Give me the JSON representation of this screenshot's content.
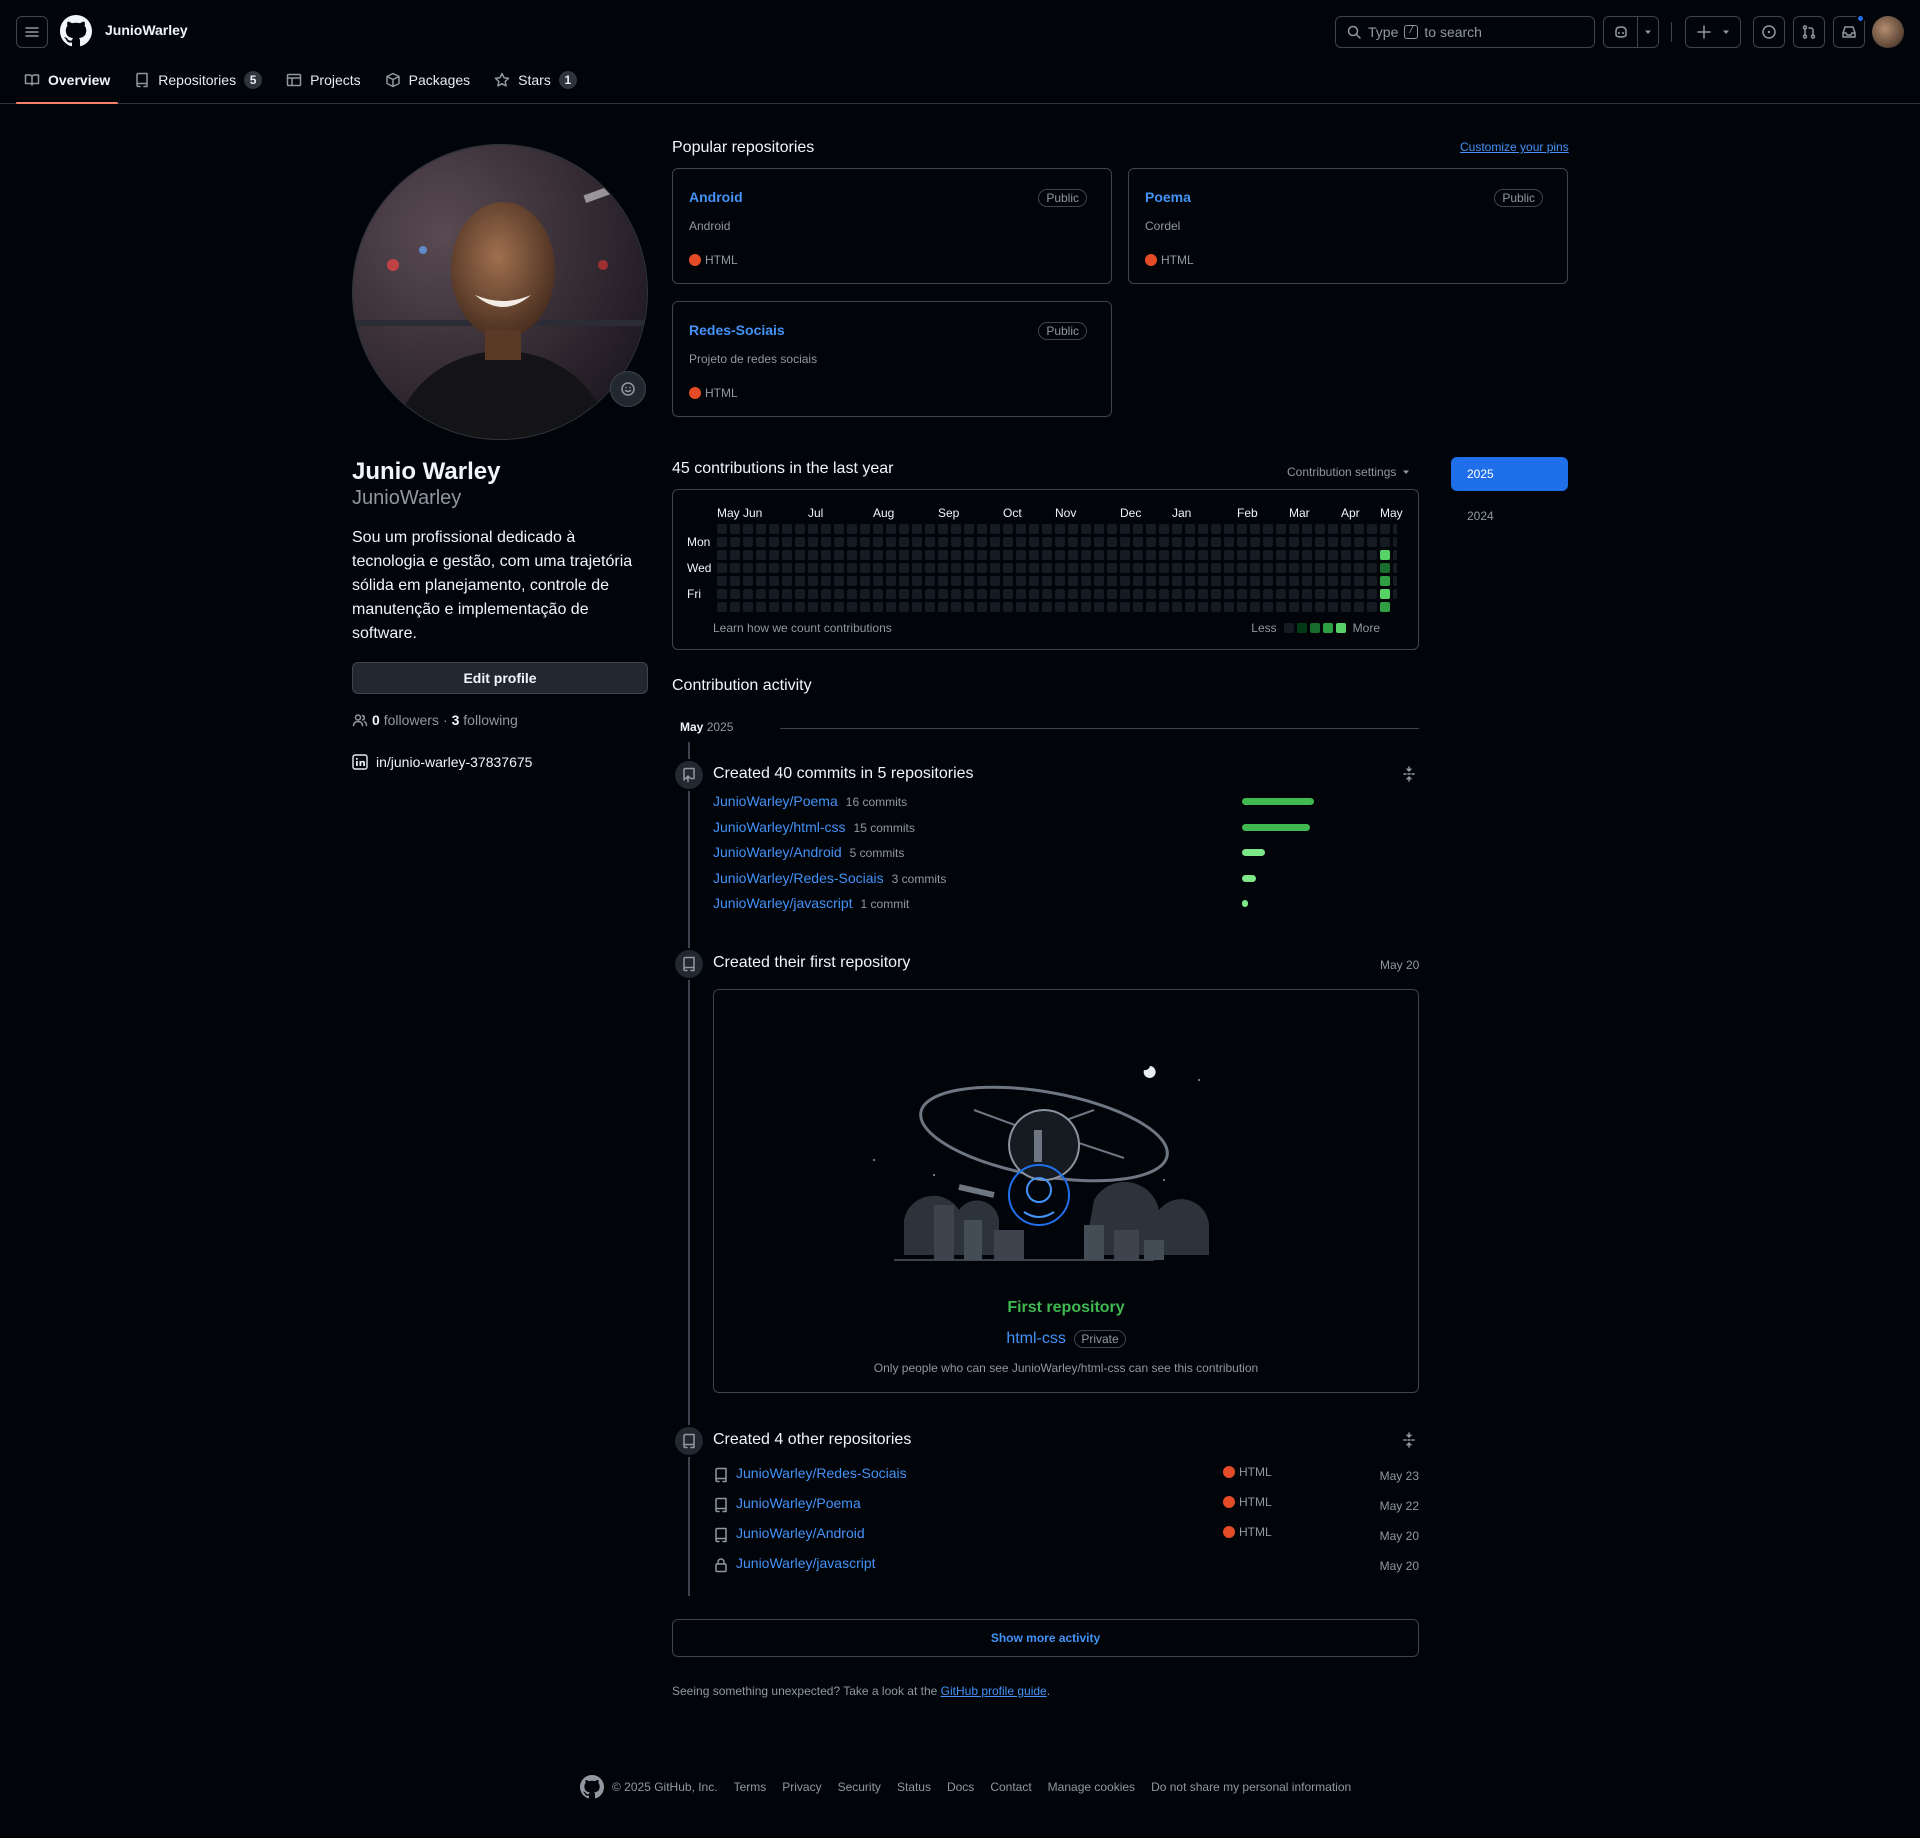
{
  "header": {
    "username": "JunioWarley",
    "search_pre": "Type",
    "search_key": "/",
    "search_post": "to search"
  },
  "tabs": [
    {
      "label": "Overview",
      "count": ""
    },
    {
      "label": "Repositories",
      "count": "5"
    },
    {
      "label": "Projects",
      "count": ""
    },
    {
      "label": "Packages",
      "count": ""
    },
    {
      "label": "Stars",
      "count": "1"
    }
  ],
  "profile": {
    "name": "Junio Warley",
    "login": "JunioWarley",
    "bio": "Sou um profissional dedicado à tecnologia e gestão, com uma trajetória sólida em planejamento, controle de manutenção e implementação de software.",
    "edit_label": "Edit profile",
    "followers_count": "0",
    "followers_label": "followers",
    "sep": "·",
    "following_count": "3",
    "following_label": "following",
    "linkedin": "in/junio-warley-37837675"
  },
  "popular": {
    "title": "Popular repositories",
    "customize": "Customize your pins",
    "repos": [
      {
        "name": "Android",
        "visibility": "Public",
        "desc": "Android",
        "lang": "HTML"
      },
      {
        "name": "Poema",
        "visibility": "Public",
        "desc": "Cordel",
        "lang": "HTML"
      },
      {
        "name": "Redes-Sociais",
        "visibility": "Public",
        "desc": "Projeto de redes sociais",
        "lang": "HTML"
      }
    ]
  },
  "contributions": {
    "title": "45 contributions in the last year",
    "settings": "Contribution settings",
    "months": [
      "May",
      "Jun",
      "Jul",
      "Aug",
      "Sep",
      "Oct",
      "Nov",
      "Dec",
      "Jan",
      "Feb",
      "Mar",
      "Apr",
      "May"
    ],
    "weekdays": [
      "Mon",
      "Wed",
      "Fri"
    ],
    "learn": "Learn how we count contributions",
    "less": "Less",
    "more": "More",
    "active_week_levels": [
      0,
      0,
      4,
      2,
      3,
      4,
      3
    ],
    "level_colors": [
      "#151b23",
      "#033a16",
      "#196c2e",
      "#2ea043",
      "#56d364"
    ]
  },
  "years": [
    "2025",
    "2024"
  ],
  "activity": {
    "title": "Contribution activity",
    "month": "May",
    "year": "2025",
    "commits": {
      "title": "Created 40 commits in 5 repositories",
      "rows": [
        {
          "repo": "JunioWarley/Poema",
          "count": "16 commits",
          "value": 16
        },
        {
          "repo": "JunioWarley/html-css",
          "count": "15 commits",
          "value": 15
        },
        {
          "repo": "JunioWarley/Android",
          "count": "5 commits",
          "value": 5
        },
        {
          "repo": "JunioWarley/Redes-Sociais",
          "count": "3 commits",
          "value": 3
        },
        {
          "repo": "JunioWarley/javascript",
          "count": "1 commit",
          "value": 1
        }
      ]
    },
    "first_repo": {
      "title": "Created their first repository",
      "date": "May 20",
      "label": "First repository",
      "repo": "html-css",
      "badge": "Private",
      "note": "Only people who can see JunioWarley/html-css can see this contribution"
    },
    "other_repos": {
      "title": "Created 4 other repositories",
      "rows": [
        {
          "repo": "JunioWarley/Redes-Sociais",
          "lang": "HTML",
          "date": "May 23"
        },
        {
          "repo": "JunioWarley/Poema",
          "lang": "HTML",
          "date": "May 22"
        },
        {
          "repo": "JunioWarley/Android",
          "lang": "HTML",
          "date": "May 20"
        },
        {
          "repo": "JunioWarley/javascript",
          "lang": "",
          "date": "May 20"
        }
      ]
    },
    "show_more": "Show more activity",
    "unexpected_pre": "Seeing something unexpected? Take a look at the",
    "unexpected_link": "GitHub profile guide",
    "unexpected_post": "."
  },
  "footer": {
    "copyright": "© 2025 GitHub, Inc.",
    "links": [
      "Terms",
      "Privacy",
      "Security",
      "Status",
      "Docs",
      "Contact",
      "Manage cookies",
      "Do not share my personal information"
    ]
  },
  "colors": {
    "accent": "#4493f8",
    "selected_tab": "#f78166",
    "html_lang": "#e34c26",
    "green": "#2ea043"
  }
}
